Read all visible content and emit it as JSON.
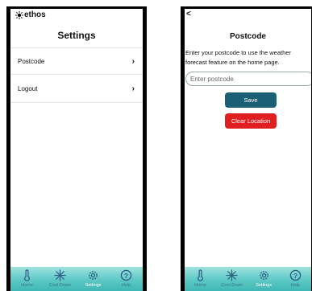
{
  "brand": {
    "name": "ethos"
  },
  "settings_screen": {
    "title": "Settings",
    "items": [
      {
        "label": "Postcode"
      },
      {
        "label": "Logout"
      }
    ]
  },
  "postcode_screen": {
    "back": "<",
    "title": "Postcode",
    "description": "Enter your postcode to use the weather forecast feature on the home page.",
    "input_placeholder": "Enter postcode",
    "save_label": "Save",
    "clear_label": "Clear Location"
  },
  "tabbar": {
    "tabs": [
      {
        "label": "Home",
        "icon": "thermometer-icon"
      },
      {
        "label": "Cool Down",
        "icon": "snowflake-icon"
      },
      {
        "label": "Settings",
        "icon": "gear-icon",
        "active": true
      },
      {
        "label": "Help",
        "icon": "help-icon"
      }
    ]
  },
  "colors": {
    "save_button": "#1a5f73",
    "clear_button": "#e02020",
    "tabbar_top": "#9fe3df",
    "tabbar_bottom": "#3fb8b5",
    "tab_icon": "#2f5f86"
  }
}
